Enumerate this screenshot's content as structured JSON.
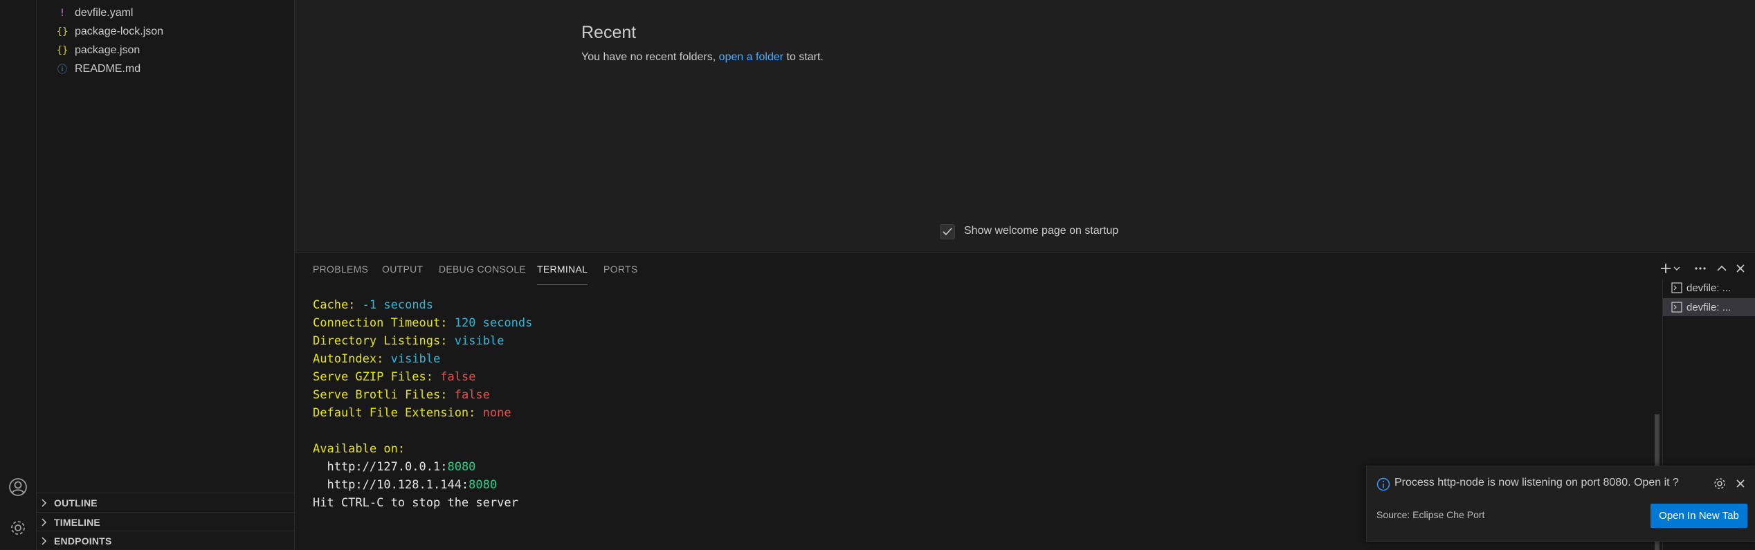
{
  "explorer": {
    "files": [
      {
        "name": "devfile.yaml",
        "icon": "yaml-icon",
        "glyph": "!",
        "color": "#c678dd"
      },
      {
        "name": "package-lock.json",
        "icon": "json-icon",
        "glyph": "{}",
        "color": "#cbcb41"
      },
      {
        "name": "package.json",
        "icon": "json-icon",
        "glyph": "{}",
        "color": "#cbcb41"
      },
      {
        "name": "README.md",
        "icon": "info-icon",
        "glyph": "ⓘ",
        "color": "#519aba"
      }
    ],
    "sections": [
      "OUTLINE",
      "TIMELINE",
      "ENDPOINTS"
    ]
  },
  "welcome": {
    "recent_title": "Recent",
    "recent_prefix": "You have no recent folders,",
    "recent_link": "open a folder",
    "recent_suffix": "to start.",
    "show_on_startup_label": "Show welcome page on startup",
    "show_on_startup_checked": true
  },
  "panel": {
    "tabs": [
      "PROBLEMS",
      "OUTPUT",
      "DEBUG CONSOLE",
      "TERMINAL",
      "PORTS"
    ],
    "active_tab": "TERMINAL",
    "terminals": [
      "devfile: ...",
      "devfile: ..."
    ]
  },
  "terminal": {
    "cache_label": "Cache:",
    "cache_value": "-1 seconds",
    "timeout_label": "Connection Timeout:",
    "timeout_value": "120 seconds",
    "dirlist_label": "Directory Listings:",
    "dirlist_value": "visible",
    "autoindex_label": "AutoIndex:",
    "autoindex_value": "visible",
    "gzip_label": "Serve GZIP Files:",
    "gzip_value": "false",
    "brotli_label": "Serve Brotli Files:",
    "brotli_value": "false",
    "ext_label": "Default File Extension:",
    "ext_value": "none",
    "available_label": "Available on:",
    "url1_host": "  http://127.0.0.1:",
    "url1_port": "8080",
    "url2_host": "  http://10.128.1.144:",
    "url2_port": "8080",
    "stop_hint": "Hit CTRL-C to stop the server"
  },
  "notification": {
    "message": "Process http-node is now listening on port 8080. Open it ?",
    "source": "Source: Eclipse Che Port",
    "button": "Open In New Tab"
  },
  "colors": {
    "accent": "#0078d4",
    "link": "#4daafc",
    "term_yellow": "#e5e510",
    "term_cyan": "#29b8db",
    "term_red": "#f14c4c",
    "term_green": "#23d18b"
  }
}
